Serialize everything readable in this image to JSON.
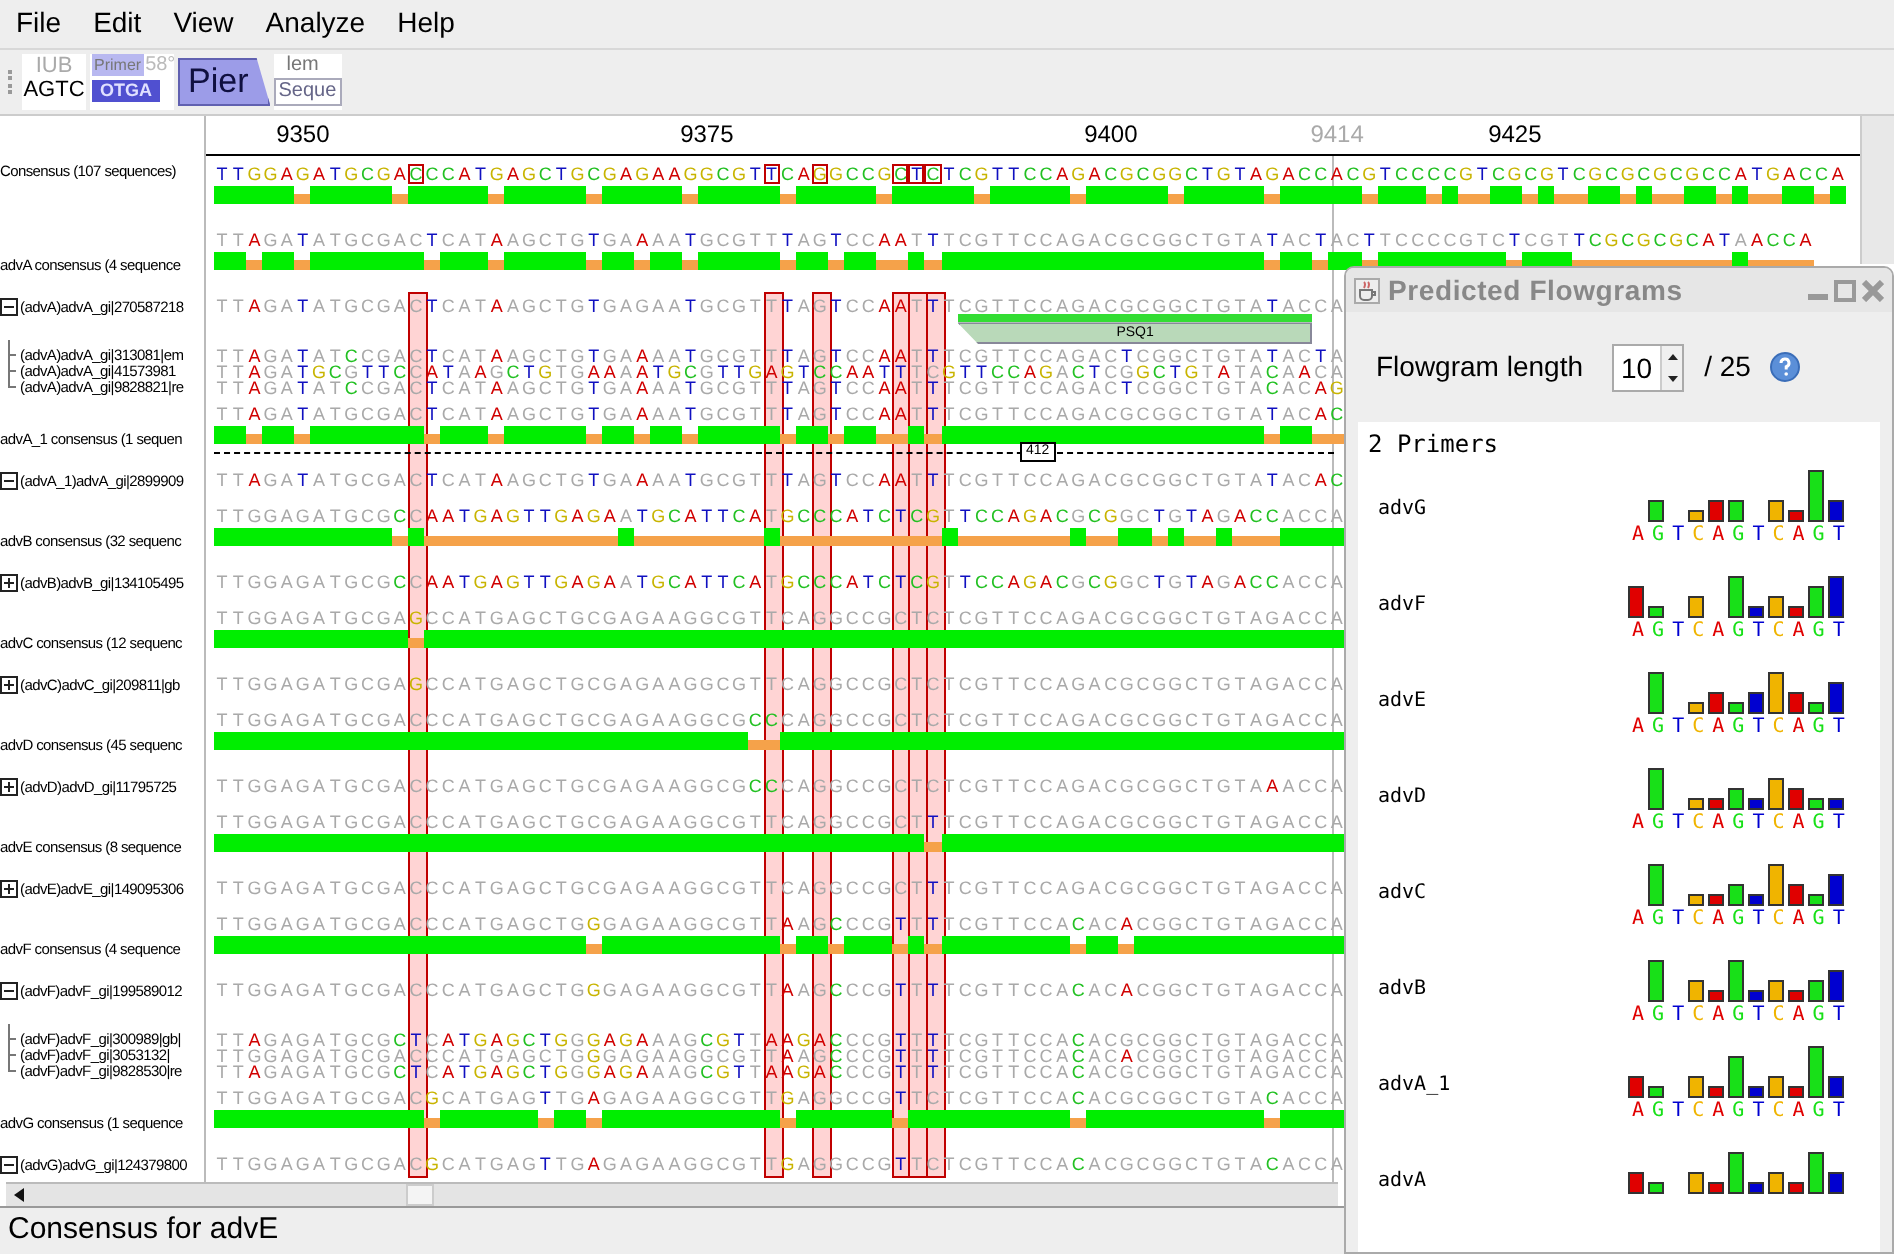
{
  "menu": [
    "File",
    "Edit",
    "View",
    "Analyze",
    "Help"
  ],
  "toolbar": [
    {
      "kind": "iub",
      "top": "IUB",
      "bottom": "AGTC"
    },
    {
      "kind": "primer",
      "top": "Primer",
      "badge": "58°",
      "bottom": "OTGA"
    },
    {
      "kind": "pier",
      "label": "Pier"
    },
    {
      "kind": "faded",
      "top": "lem",
      "bottom": "Seque"
    }
  ],
  "ruler": [
    {
      "label": "9350",
      "kind": "tick"
    },
    {
      "label": "9375",
      "kind": "tick"
    },
    {
      "label": "9400",
      "kind": "tick"
    },
    {
      "label": "9414",
      "kind": "marker"
    },
    {
      "label": "9425",
      "kind": "tick"
    }
  ],
  "alignment": [
    {
      "kind": "consensus",
      "label": "Consensus (107 sequences)",
      "sequence": "TTGGAGATGCGACCCATGAGCTGCGAGAAGGCGTTCAGGCCGCTCTCGTTCCAGACGCGGCTGTAGACCACGTCCCCGTCGCGTCGCGCGCGCCATGACCA"
    },
    {
      "kind": "consensus",
      "label": "advA consensus (4 sequence",
      "sequence": "TTAGATATGCGACTCATAAGCTGTGAAAATGCGTTTAGTCCAATTTCGTTCCAGACGCGGCTGTATACTACTTCCCCGTCTCGTTCGCGCGCATAACCA"
    },
    {
      "kind": "group",
      "label": "(advA)advA_gi|270587218",
      "expanded": true,
      "sequence": "TTAGATATGCGACTCATAAGCTGTGAGAATGCGTTTAGTCCAATTTCGTTCCAGACGCGGCTGTATACCA",
      "feature": {
        "label": "PSQ1"
      },
      "children": [
        {
          "label": "(advA)advA_gi|313081|em",
          "sequence": "TTAGATATCCGACTCATAAGCTGTGAAAATGCGTTTAGTCCAATTTCGTTCCAGACTCGGCTGTATACTA"
        },
        {
          "label": "(advA)advA_gi|41573981",
          "sequence": "TTAGATGCGTTCCATAAGCTGTGAAAATGCGTTGAGTCCAATTTCGTTCCAGACTCGGCTGTATACAACA"
        },
        {
          "label": "(advA)advA_gi|9828821|re",
          "sequence": "TTAGATATCCGACTCATAAGCTGTGAAAATGCGTTTAGTCCAATTTCGTTCCAGACTCGGCTGTACACAG"
        }
      ]
    },
    {
      "kind": "consensus",
      "label": "advA_1 consensus (1 sequen",
      "sequence": "TTAGATATGCGACTCATAAGCTGTGAAAATGCGTTTAGTCCAATTTCGTTCCAGACGCGGCTGTATACAC",
      "gap_label": "412"
    },
    {
      "kind": "group",
      "label": "(advA_1)advA_gi|2899909",
      "expanded": true,
      "sequence": "TTAGATATGCGACTCATAAGCTGTGAAAATGCGTTTAGTCCAATTTCGTTCCAGACGCGGCTGTATACAC"
    },
    {
      "kind": "consensus",
      "label": "advB consensus (32 sequenc",
      "sequence": "TTGGAGATGCGCCAATGAGTTGAGAATGCATTCATGCCCATCTCGTTCCAGACGCGGCTGTAGACCACCA"
    },
    {
      "kind": "group",
      "label": "(advB)advB_gi|134105495",
      "expanded": false,
      "sequence": "TTGGAGATGCGCCAATGAGTTGAGAATGCATTCATGCCCATCTCGTTCCAGACGCGGCTGTAGACCACCA"
    },
    {
      "kind": "consensus",
      "label": "advC consensus (12 sequenc",
      "sequence": "TTGGAGATGCGAGCCATGAGCTGCGAGAAGGCGTTCAGGCCGCTCTCGTTCCAGACGCGGCTGTAGACCA"
    },
    {
      "kind": "group",
      "label": "(advC)advC_gi|209811|gb",
      "expanded": false,
      "sequence": "TTGGAGATGCGAGCCATGAGCTGCGAGAAGGCGTTCAGGCCGCTCTCGTTCCAGACGCGGCTGTAGACCA"
    },
    {
      "kind": "consensus",
      "label": "advD consensus (45 sequenc",
      "sequence": "TTGGAGATGCGACCCATGAGCTGCGAGAAGGCGCCCAGGCCGCTCTCGTTCCAGACGCGGCTGTAGACCA"
    },
    {
      "kind": "group",
      "label": "(advD)advD_gi|11795725",
      "expanded": false,
      "sequence": "TTGGAGATGCGACCCATGAGCTGCGAGAAGGCGCCCAGGCCGCTCTCGTTCCAGACGCGGCTGTAAACCA"
    },
    {
      "kind": "consensus",
      "label": "advE consensus (8 sequence",
      "sequence": "TTGGAGATGCGACCCATGAGCTGCGAGAAGGCGTTCAGGCCGCTTTCGTTCCAGACGCGGCTGTAGACCA"
    },
    {
      "kind": "group",
      "label": "(advE)advE_gi|149095306",
      "expanded": false,
      "sequence": "TTGGAGATGCGACCCATGAGCTGCGAGAAGGCGTTCAGGCCGCTTTCGTTCCAGACGCGGCTGTAGACCA"
    },
    {
      "kind": "consensus",
      "label": "advF consensus (4 sequence",
      "sequence": "TTGGAGATGCGACCCATGAGCTGGGAGAAGGCGTTAAGCCCGTTTTCGTTCCACACACGGCTGTAGACCA"
    },
    {
      "kind": "group",
      "label": "(advF)advF_gi|199589012",
      "expanded": true,
      "sequence": "TTGGAGATGCGACCCATGAGCTGGGAGAAGGCGTTAAGCCCGTTTTCGTTCCACACACGGCTGTAGACCA",
      "children": [
        {
          "label": "(advF)advF_gi|300989|gb|",
          "sequence": "TTAGAGATGCGCTCATGAGCTGGGAGAAAGCGTTAAGACCCGTTTTCGTTCCACACGCGGCTGTAGACCA"
        },
        {
          "label": "(advF)advF_gi|3053132|",
          "sequence": "TTGGAGATGCGACCCATGAGCTGGGAGAAGGCGTTAAGCCCGTTTTCGTTCCACACACGGCTGTAGACCA"
        },
        {
          "label": "(advF)advF_gi|9828530|re",
          "sequence": "TTAGAGATGCGCTCATGAGCTGGGAGAAAGCGTTAAGACCCGTTTTCGTTCCACACGCGGCTGTAGACCA"
        }
      ]
    },
    {
      "kind": "consensus",
      "label": "advG consensus (1 sequence",
      "sequence": "TTGGAGATGCGACGCATGAGTTGAGAGAAGGCGTTGAGGCCGTTCTCGTTCCACACGCGGCTGTACACCA"
    },
    {
      "kind": "group",
      "label": "(advG)advG_gi|124379800",
      "expanded": true,
      "sequence": "TTGGAGATGCGACGCATGAGTTGAGAGAAGGCGTTGAGGCCGTTCTCGTTCCACACGCGGCTGTACACCA"
    }
  ],
  "status_bar": "Consensus for advE",
  "flowgram_panel": {
    "title": "Predicted Flowgrams",
    "length_label": "Flowgram length",
    "length_value": "10",
    "length_total": "/ 25",
    "heading": "2 Primers",
    "primers": [
      {
        "name": "advG",
        "flow": "AGTCAGTCAGT"
      },
      {
        "name": "advF",
        "flow": "AGTCAGTCAGT"
      },
      {
        "name": "advE",
        "flow": "AGTCAGTCAGT"
      },
      {
        "name": "advD",
        "flow": "AGTCAGTCAGT"
      },
      {
        "name": "advC",
        "flow": "AGTCAGTCAGT"
      },
      {
        "name": "advB",
        "flow": "AGTCAGTCAGT"
      },
      {
        "name": "advA_1",
        "flow": "AGTCAGTCAGT"
      },
      {
        "name": "advA"
      }
    ]
  }
}
